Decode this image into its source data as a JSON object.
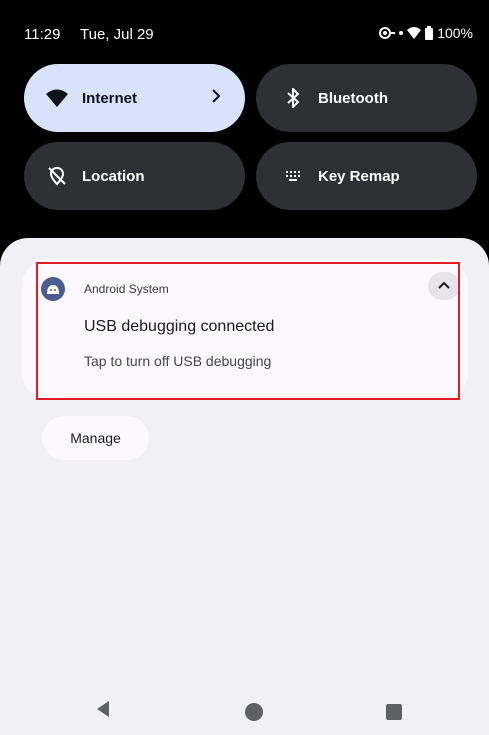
{
  "status_bar": {
    "time": "11:29",
    "date": "Tue, Jul 29",
    "battery": "100%",
    "icons": [
      "data-saver-icon",
      "wifi-icon",
      "battery-icon"
    ]
  },
  "quick_settings": {
    "tiles": [
      {
        "label": "Internet",
        "icon": "wifi-icon",
        "active": true,
        "has_chevron": true
      },
      {
        "label": "Bluetooth",
        "icon": "bluetooth-icon",
        "active": false
      },
      {
        "label": "Location",
        "icon": "location-off-icon",
        "active": false
      },
      {
        "label": "Key Remap",
        "icon": "keyboard-icon",
        "active": false
      }
    ]
  },
  "notification": {
    "app_name": "Android System",
    "title": "USB debugging connected",
    "text": "Tap to turn off USB debugging",
    "highlight_color": "#e31b23"
  },
  "actions": {
    "manage_label": "Manage"
  },
  "nav_bar": {
    "buttons": [
      "back-icon",
      "home-icon",
      "recents-icon"
    ]
  },
  "colors": {
    "active_tile": "#d8e2fb",
    "inactive_tile": "#2e3033",
    "shade_background": "#f1f0f4"
  }
}
